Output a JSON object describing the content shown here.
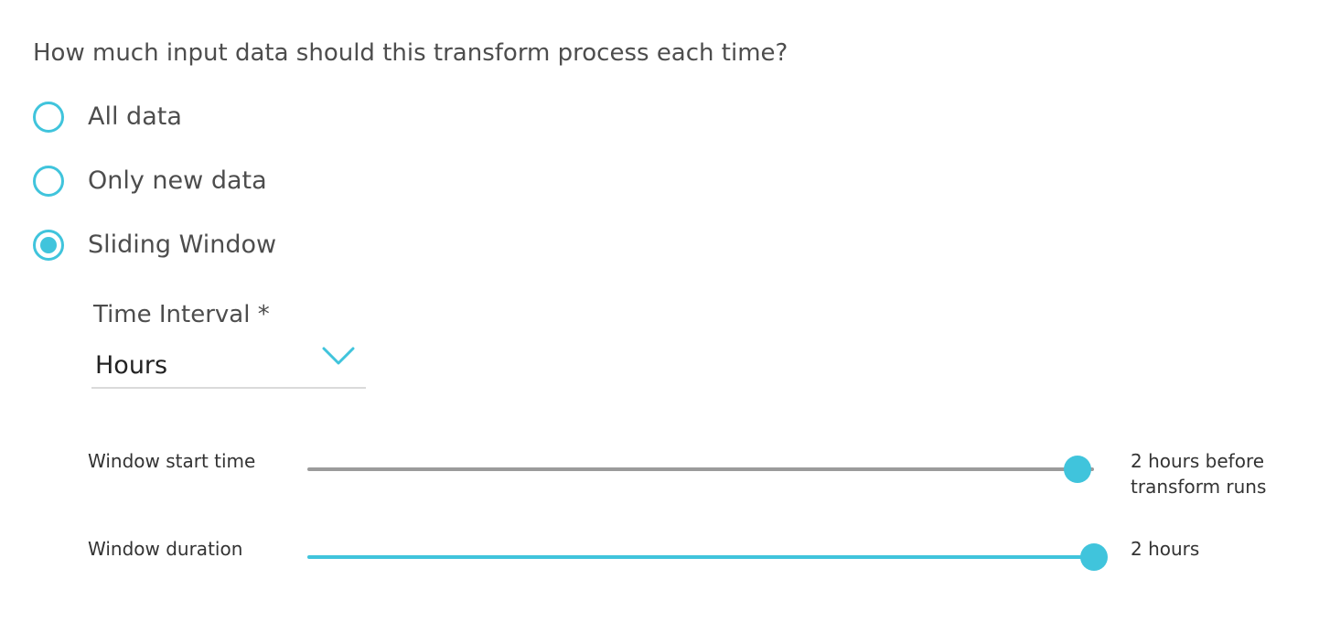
{
  "question": "How much input data should this transform process each time?",
  "options": [
    {
      "label": "All data",
      "selected": false
    },
    {
      "label": "Only new data",
      "selected": false
    },
    {
      "label": "Sliding Window",
      "selected": true
    }
  ],
  "time_interval": {
    "label": "Time Interval *",
    "value": "Hours"
  },
  "sliders": {
    "start": {
      "label": "Window start time",
      "value_line1": "2 hours before",
      "value_line2": "transform runs"
    },
    "duration": {
      "label": "Window duration",
      "value": "2 hours"
    }
  },
  "colors": {
    "accent": "#40c4dc",
    "inactive_track": "#9b9b9b"
  },
  "icons": {
    "select_toggle": "chevron-down-icon"
  }
}
